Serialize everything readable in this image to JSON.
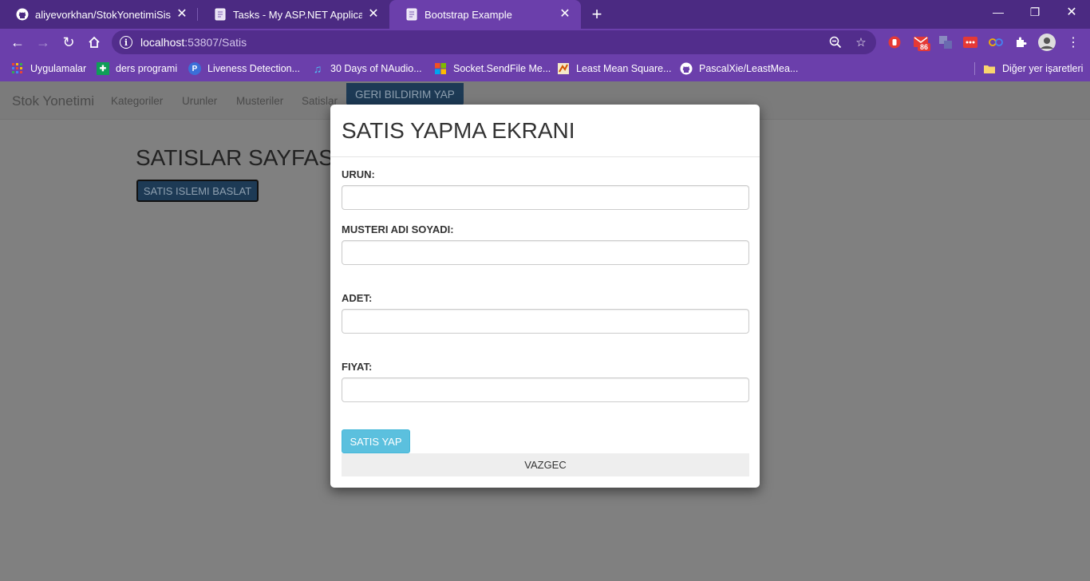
{
  "browser": {
    "tabs": [
      {
        "title": "aliyevorkhan/StokYonetimiSistemi",
        "icon": "github-icon"
      },
      {
        "title": "Tasks - My ASP.NET Application",
        "icon": "page-icon"
      },
      {
        "title": "Bootstrap Example",
        "icon": "page-icon",
        "active": true
      }
    ],
    "url_host": "localhost",
    "url_path": ":53807/Satis",
    "extension_badge": "86",
    "bookmarks": [
      {
        "label": "Uygulamalar",
        "icon": "apps-grid-icon"
      },
      {
        "label": "ders programi",
        "icon": "green-sheet-icon"
      },
      {
        "label": "Liveness Detection...",
        "icon": "p-logo-icon"
      },
      {
        "label": "30 Days of NAudio...",
        "icon": "music-note-icon"
      },
      {
        "label": "Socket.SendFile Me...",
        "icon": "microsoft-logo-icon"
      },
      {
        "label": "Least Mean Square...",
        "icon": "matlab-logo-icon"
      },
      {
        "label": "PascalXie/LeastMea...",
        "icon": "github-icon"
      }
    ],
    "other_bookmarks": "Diğer yer işaretleri"
  },
  "page": {
    "brand": "Stok Yonetimi",
    "nav": [
      "Kategoriler",
      "Urunler",
      "Musteriler",
      "Satislar"
    ],
    "feedback_button": "GERI BILDIRIM YAP",
    "heading": "SATISLAR SAYFASI",
    "start_button": "SATIS ISLEMI BASLAT"
  },
  "modal": {
    "title": "SATIS YAPMA EKRANI",
    "fields": [
      {
        "label": "URUN:",
        "value": ""
      },
      {
        "label": "MUSTERI ADI SOYADI:",
        "value": ""
      },
      {
        "label": "ADET:",
        "value": ""
      },
      {
        "label": "FIYAT:",
        "value": ""
      }
    ],
    "submit_button": "SATIS YAP",
    "cancel_button": "VAZGEC"
  },
  "colors": {
    "chrome_frame": "#4b2a82",
    "chrome_toolbar": "#6b3fab",
    "backdrop": "#808080",
    "info_button": "#5bc0de",
    "dark_button": "#1d3a55"
  }
}
